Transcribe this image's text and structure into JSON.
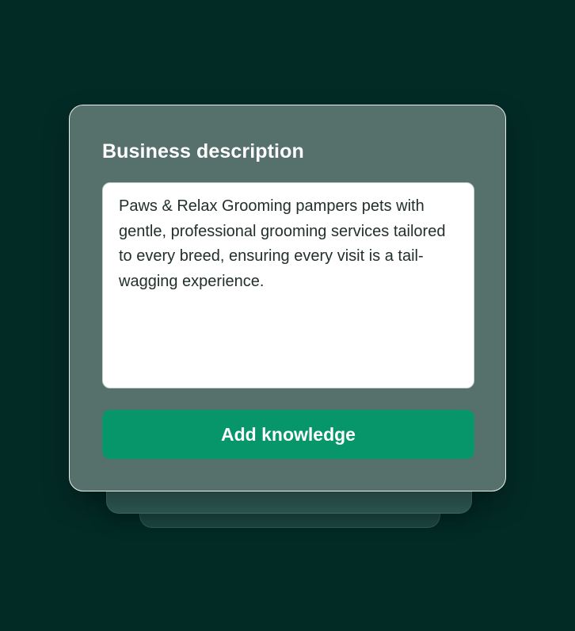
{
  "form": {
    "title": "Business description",
    "description_value": "Paws & Relax Grooming pampers pets with gentle, professional grooming services tailored to every breed, ensuring every visit is a tail-wagging experience.",
    "submit_label": "Add knowledge"
  },
  "colors": {
    "background": "#032b26",
    "card": "#56706b",
    "button": "#06966a"
  }
}
